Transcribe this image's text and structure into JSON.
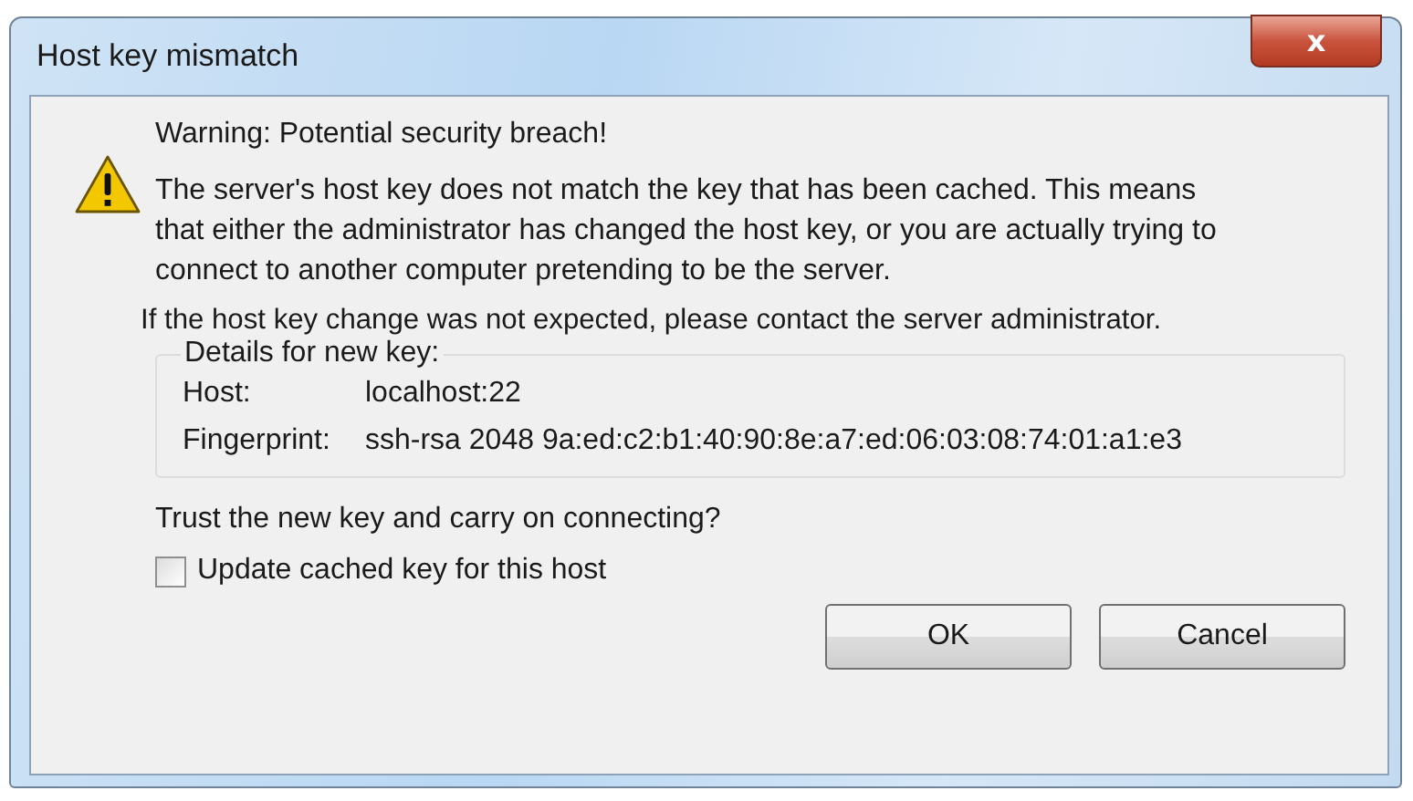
{
  "window": {
    "title": "Host key mismatch",
    "close": "x"
  },
  "heading": "Warning: Potential security breach!",
  "message": "The server's host key does not match the key that has been cached. This means that either the administrator has changed the host key, or you are actually trying to connect to another computer pretending to be the server.",
  "note": "If the host key change was not expected, please contact the server administrator.",
  "details": {
    "legend": "Details for new key:",
    "rows": [
      {
        "label": "Host:",
        "value": "localhost:22"
      },
      {
        "label": "Fingerprint:",
        "value": "ssh-rsa 2048 9a:ed:c2:b1:40:90:8e:a7:ed:06:03:08:74:01:a1:e3"
      }
    ]
  },
  "question": "Trust the new key and carry on connecting?",
  "checkbox": {
    "label": "Update cached key for this host",
    "checked": false
  },
  "buttons": [
    "OK",
    "Cancel"
  ]
}
